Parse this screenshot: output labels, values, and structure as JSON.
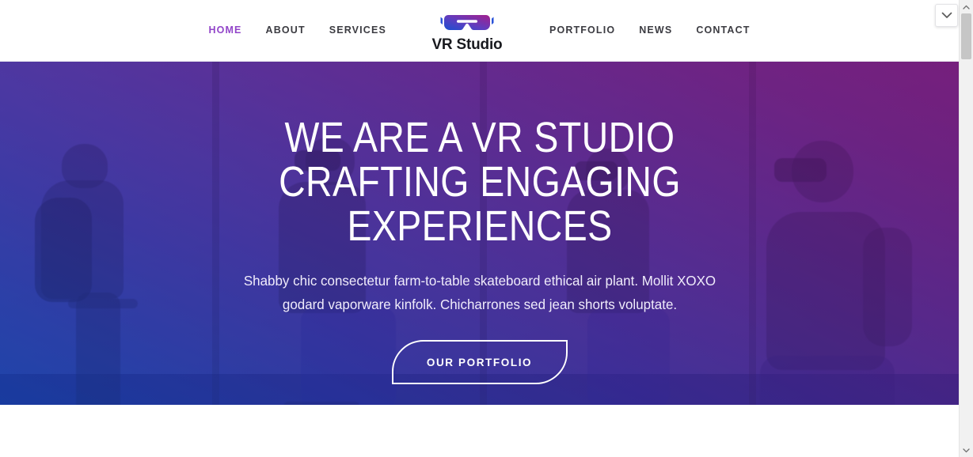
{
  "site": {
    "brand_name": "VR Studio",
    "logo_icon": "vr-headset-icon"
  },
  "header": {
    "nav_left": [
      {
        "label": "HOME",
        "active": true
      },
      {
        "label": "ABOUT",
        "active": false
      },
      {
        "label": "SERVICES",
        "active": false
      }
    ],
    "nav_right": [
      {
        "label": "PORTFOLIO",
        "active": false
      },
      {
        "label": "NEWS",
        "active": false
      },
      {
        "label": "CONTACT",
        "active": false
      }
    ]
  },
  "hero": {
    "title": "WE ARE A VR STUDIO CRAFTING ENGAGING EXPERIENCES",
    "subtitle": "Shabby chic consectetur farm-to-table skateboard ethical air plant. Mollit XOXO godard vaporware kinfolk. Chicharrones sed jean shorts voluptate.",
    "cta_label": "OUR PORTFOLIO"
  },
  "colors": {
    "active_nav": "#9245c9",
    "nav_text": "#3b3b41",
    "brand_text": "#191a1f",
    "gradient_start_blue": "#1f53c7",
    "gradient_mid_purple": "#5c3fbd",
    "gradient_end_magenta": "#a01d90",
    "hero_text": "#ffffff",
    "page_background": "#ffffff"
  },
  "browser_chrome": {
    "scroll_up_icon": "chevron-up-icon",
    "scroll_down_icon": "chevron-down-icon",
    "widget_icon": "chevron-down-icon"
  }
}
